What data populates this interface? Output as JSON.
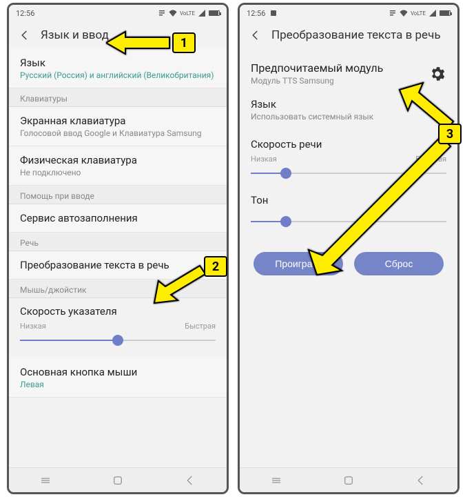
{
  "status": {
    "time": "12:56"
  },
  "left": {
    "header": "Язык и ввод",
    "language": {
      "title": "Язык",
      "sub": "Русский (Россия) и английский (Великобритания)"
    },
    "sec_keyboards": "Клавиатуры",
    "screen_kb": {
      "title": "Экранная клавиатура",
      "sub": "Голосовой ввод Google и Клавиатура Samsung"
    },
    "phys_kb": {
      "title": "Физическая клавиатура",
      "sub": "Не подключено"
    },
    "sec_assist": "Помощь при вводе",
    "autofill": {
      "title": "Сервис автозаполнения"
    },
    "sec_speech": "Речь",
    "tts": {
      "title": "Преобразование текста в речь"
    },
    "sec_mouse": "Мышь/джойстик",
    "pointer": {
      "title": "Скорость указателя",
      "low": "Низкая",
      "high": "Быстрая",
      "pos": 50
    },
    "mouse_btn": {
      "title": "Основная кнопка мыши",
      "sub": "Левая"
    }
  },
  "right": {
    "header": "Преобразование текста в речь",
    "module": {
      "title": "Предпочитаемый модуль",
      "sub": "Модуль TTS Samsung"
    },
    "language": {
      "title": "Язык",
      "sub": "Использовать системный язык"
    },
    "speed": {
      "title": "Скорость речи",
      "low": "Низкая",
      "high": "Быстрая",
      "pos": 18
    },
    "tone": {
      "title": "Тон",
      "pos": 18
    },
    "play": "Проиграть",
    "reset": "Сброс"
  },
  "annotations": {
    "n1": "1",
    "n2": "2",
    "n3": "3"
  }
}
